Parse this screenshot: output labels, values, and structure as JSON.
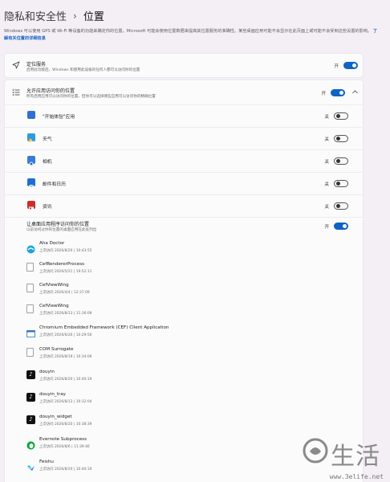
{
  "header": {
    "breadcrumb_parent": "隐私和安全性",
    "separator": "›",
    "title": "位置"
  },
  "description": {
    "text": "Windows 可以使用 GPS 或 Wi-Fi 等设备的功能来确定你的位置。Microsoft 可能会使用位置数据来提高其位置服务的准确性。某些桌面应用可能不会显示在此页面上或可能不会受到这些设置的影响。",
    "link": "了解有关位置的详细信息"
  },
  "location_services": {
    "icon": "location-arrow-icon",
    "title": "定位服务",
    "subtitle": "启用此功能后，Windows 和使用此设备的任何人都可以访问你的位置",
    "state": "开",
    "on": true
  },
  "app_access": {
    "icon": "list-icon",
    "title": "允许应用访问你的位置",
    "subtitle": "所有启用应用可以访问你的位置，但你可以选择哪些应用可以访问你的精确位置",
    "state": "开",
    "on": true,
    "apps": [
      {
        "name": "\"开始体验\"应用",
        "icon": "get-started-icon",
        "color": "#2f6fd6",
        "state": "关",
        "on": false
      },
      {
        "name": "天气",
        "icon": "weather-icon",
        "color": "#2f9ae0",
        "state": "关",
        "on": false
      },
      {
        "name": "相机",
        "icon": "camera-icon",
        "color": "#3a7bd5",
        "state": "关",
        "on": false
      },
      {
        "name": "邮件和日历",
        "icon": "mail-icon",
        "color": "#1f6fd0",
        "state": "关",
        "on": false
      },
      {
        "name": "资讯",
        "icon": "news-icon",
        "color": "#d02c2c",
        "state": "关",
        "on": false
      }
    ]
  },
  "desktop_access": {
    "title": "让桌面应用程序访问你的位置",
    "subtitle": "以前访问过你的位置的桌面应用在此处列出",
    "state": "开",
    "on": true,
    "apps": [
      {
        "name": "Aha Doctor",
        "time": "上次访问 2026/8/20 | 10:43:55",
        "icon": "aha-doctor-icon"
      },
      {
        "name": "CefRendererProcess",
        "time": "上次访问 2026/5/21 | 19:52:11",
        "icon": "file-icon"
      },
      {
        "name": "CefViewWing",
        "time": "上次访问 2026/4/4 | 12:37:09",
        "icon": "file-icon"
      },
      {
        "name": "CefViewWing",
        "time": "上次访问 2026/8/13 | 11:36:09",
        "icon": "file-icon"
      },
      {
        "name": "Chromium Embedded Framework (CEF) Client Application",
        "time": "上次访问 2026/6/26 | 10:29:56",
        "icon": "window-icon"
      },
      {
        "name": "COM Surrogate",
        "time": "上次访问 2026/8/19 | 10:34:06",
        "icon": "file-icon"
      },
      {
        "name": "douyin",
        "time": "上次访问 2026/8/20 | 10:40:19",
        "icon": "douyin-icon"
      },
      {
        "name": "douyin_tray",
        "time": "上次访问 2026/8/13 | 10:32:04",
        "icon": "douyin-icon"
      },
      {
        "name": "douyin_widget",
        "time": "上次访问 2026/8/20 | 10:38:39",
        "icon": "douyin-icon"
      },
      {
        "name": "Evernote Subprocess",
        "time": "上次访问 2026/8/6 | 11:39:46",
        "icon": "evernote-icon"
      },
      {
        "name": "Feishu",
        "time": "上次访问 2026/8/20 | 10:40:19",
        "icon": "feishu-icon"
      }
    ]
  },
  "watermark": {
    "text": "生活",
    "url": "www.3elife.net"
  }
}
